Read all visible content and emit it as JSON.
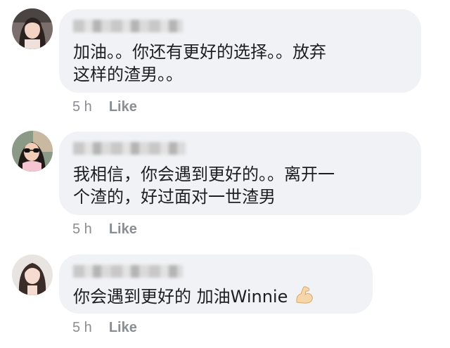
{
  "comments": [
    {
      "avatar": "avatar-woman-dark-hair-icon",
      "text": "加油。。你还有更好的选择。。放弃\n这样的渣男。。",
      "time": "5 h",
      "like": "Like"
    },
    {
      "avatar": "avatar-woman-sunglasses-icon",
      "text": "我相信，你会遇到更好的。。离开一\n个渣的，好过面对一世渣男",
      "time": "5 h",
      "like": "Like"
    },
    {
      "avatar": "avatar-woman-long-hair-icon",
      "text": "你会遇到更好的 加油Winnie",
      "emoji": "flexed-biceps-emoji",
      "time": "5 h",
      "like": "Like"
    }
  ],
  "colors": {
    "bubble": "#f0f2f5",
    "text": "#1c1e21",
    "meta": "#8a8d91"
  }
}
